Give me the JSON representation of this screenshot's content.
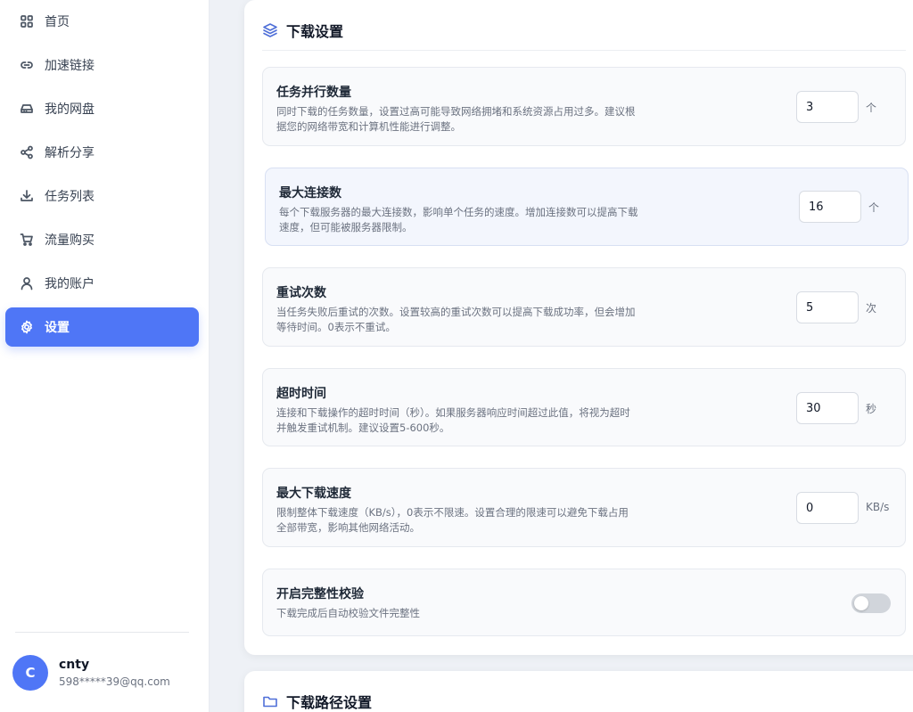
{
  "sidebar": {
    "items": [
      {
        "label": "首页",
        "icon": "grid-icon"
      },
      {
        "label": "加速链接",
        "icon": "link-icon"
      },
      {
        "label": "我的网盘",
        "icon": "drive-icon"
      },
      {
        "label": "解析分享",
        "icon": "share-icon"
      },
      {
        "label": "任务列表",
        "icon": "download-icon"
      },
      {
        "label": "流量购买",
        "icon": "cart-icon"
      },
      {
        "label": "我的账户",
        "icon": "user-icon"
      },
      {
        "label": "设置",
        "icon": "gear-icon",
        "active": true
      }
    ],
    "user": {
      "initial": "C",
      "name": "cnty",
      "email": "598*****39@qq.com"
    }
  },
  "download_settings": {
    "title": "下载设置",
    "icon": "layers-icon",
    "items": [
      {
        "title": "任务并行数量",
        "desc": "同时下载的任务数量，设置过高可能导致网络拥堵和系统资源占用过多。建议根据您的网络带宽和计算机性能进行调整。",
        "value": "3",
        "unit": "个"
      },
      {
        "title": "最大连接数",
        "desc": "每个下载服务器的最大连接数，影响单个任务的速度。增加连接数可以提高下载速度，但可能被服务器限制。",
        "value": "16",
        "unit": "个"
      },
      {
        "title": "重试次数",
        "desc": "当任务失败后重试的次数。设置较高的重试次数可以提高下载成功率，但会增加等待时间。0表示不重试。",
        "value": "5",
        "unit": "次"
      },
      {
        "title": "超时时间",
        "desc": "连接和下载操作的超时时间（秒）。如果服务器响应时间超过此值，将视为超时并触发重试机制。建议设置5-600秒。",
        "value": "30",
        "unit": "秒"
      },
      {
        "title": "最大下载速度",
        "desc": "限制整体下载速度（KB/s），0表示不限速。设置合理的限速可以避免下载占用全部带宽，影响其他网络活动。",
        "value": "0",
        "unit": "KB/s"
      },
      {
        "title": "开启完整性校验",
        "desc": "下载完成后自动校验文件完整性",
        "enabled": false
      }
    ]
  },
  "path_settings": {
    "title": "下载路径设置",
    "icon": "folder-icon"
  },
  "colors": {
    "accent": "#4f76f6",
    "toggle_off": "#d1d5db"
  }
}
